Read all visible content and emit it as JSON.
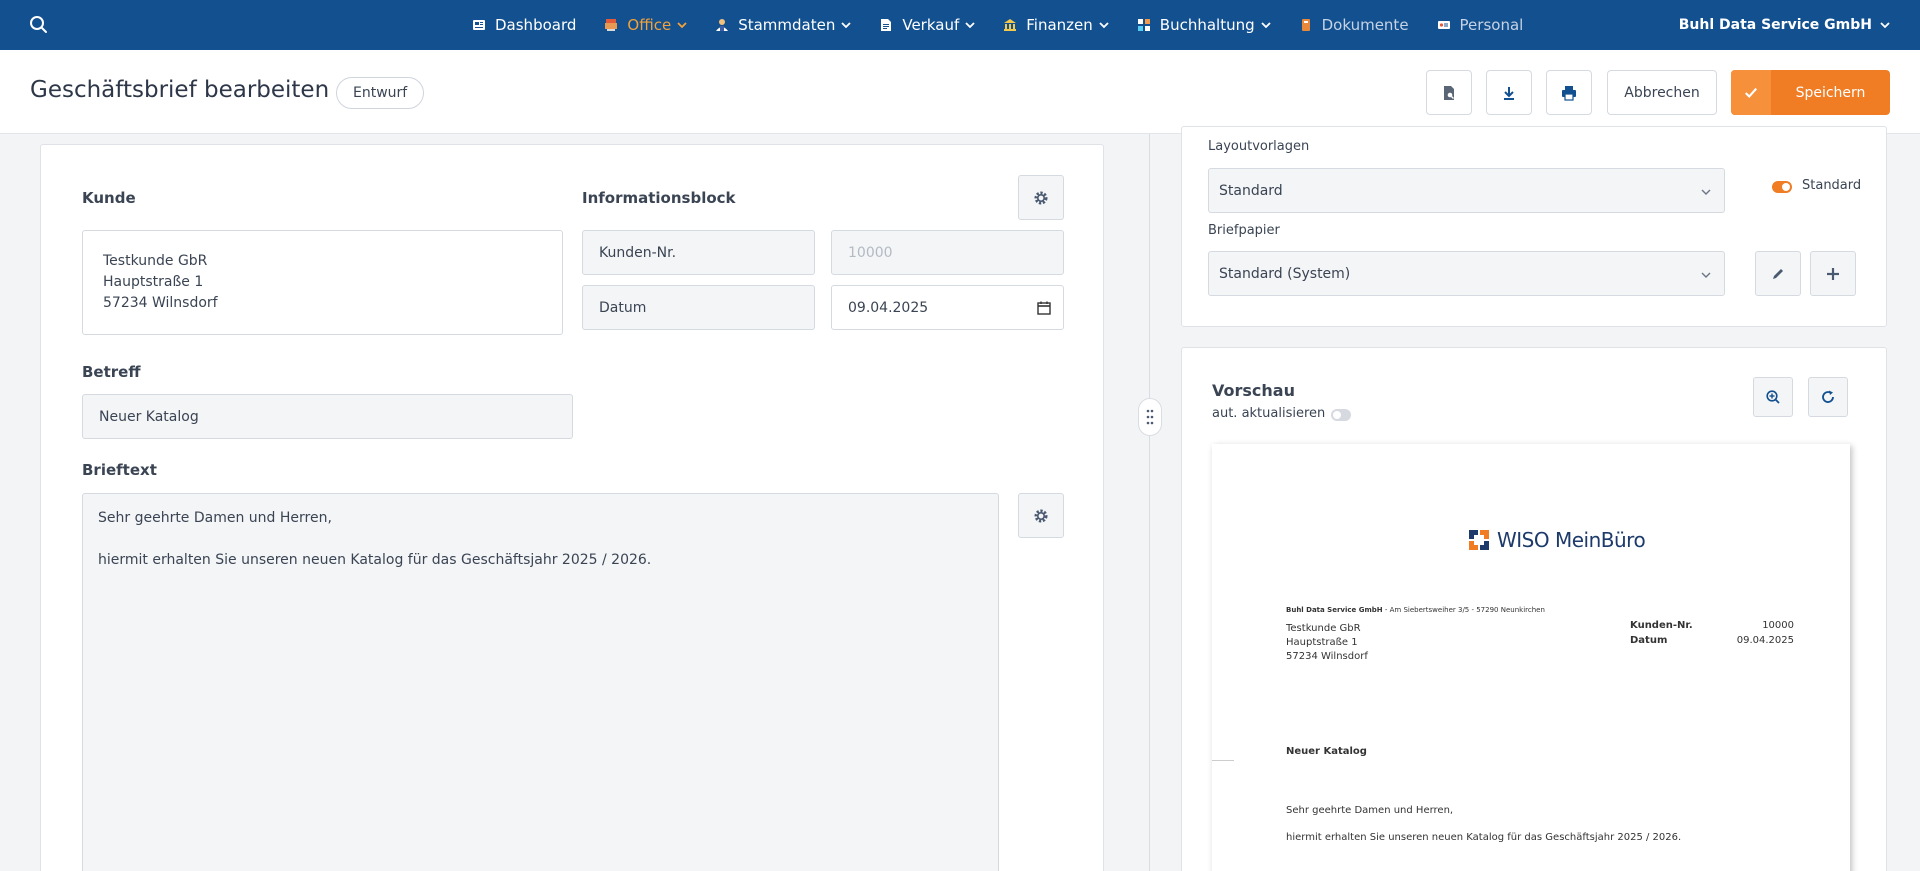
{
  "nav": {
    "items": [
      {
        "label": "Dashboard",
        "icon": "dashboard-icon",
        "has_dropdown": false
      },
      {
        "label": "Office",
        "icon": "office-icon",
        "has_dropdown": true,
        "active": true
      },
      {
        "label": "Stammdaten",
        "icon": "person-icon",
        "has_dropdown": true
      },
      {
        "label": "Verkauf",
        "icon": "document-icon",
        "has_dropdown": true
      },
      {
        "label": "Finanzen",
        "icon": "bank-icon",
        "has_dropdown": true
      },
      {
        "label": "Buchhaltung",
        "icon": "ledger-icon",
        "has_dropdown": true
      },
      {
        "label": "Dokumente",
        "icon": "folder-icon",
        "has_dropdown": false
      },
      {
        "label": "Personal",
        "icon": "id-card-icon",
        "has_dropdown": false
      }
    ],
    "company": "Buhl Data Service GmbH"
  },
  "header": {
    "title": "Geschäftsbrief bearbeiten",
    "status_badge": "Entwurf",
    "cancel_label": "Abbrechen",
    "save_label": "Speichern"
  },
  "form": {
    "customer_label": "Kunde",
    "customer_lines": [
      "Testkunde GbR",
      "Hauptstraße 1",
      "57234 Wilnsdorf"
    ],
    "infoblock_label": "Informationsblock",
    "customer_no_label": "Kunden-Nr.",
    "customer_no_placeholder": "10000",
    "date_label": "Datum",
    "date_value": "09.04.2025",
    "subject_label": "Betreff",
    "subject_value": "Neuer Katalog",
    "body_label": "Brieftext",
    "body_paragraphs": [
      "Sehr geehrte Damen und Herren,",
      "hiermit erhalten Sie unseren neuen Katalog für das Geschäftsjahr 2025 / 2026."
    ]
  },
  "layout": {
    "template_label": "Layoutvorlagen",
    "template_value": "Standard",
    "standard_toggle_label": "Standard",
    "letterhead_label": "Briefpapier",
    "letterhead_value": "Standard (System)"
  },
  "preview": {
    "title": "Vorschau",
    "auto_update_label": "aut. aktualisieren",
    "logo_text": "WISO MeinBüro",
    "sender_bold": "Buhl Data Service GmbH",
    "sender_rest": " - Am Siebertsweiher 3/5 - 57290 Neunkirchen",
    "addr_lines": [
      "Testkunde GbR",
      "Hauptstraße 1",
      "57234 Wilnsdorf"
    ],
    "info_rows": [
      {
        "label": "Kunden-Nr.",
        "value": "10000"
      },
      {
        "label": "Datum",
        "value": "09.04.2025"
      }
    ],
    "subject": "Neuer Katalog",
    "body_paragraphs": [
      "Sehr geehrte Damen und Herren,",
      "hiermit erhalten Sie unseren neuen Katalog für das Geschäftsjahr 2025 / 2026."
    ]
  },
  "colors": {
    "nav_bg": "#13508f",
    "accent": "#f07c23",
    "active_nav": "#f2a23a"
  }
}
